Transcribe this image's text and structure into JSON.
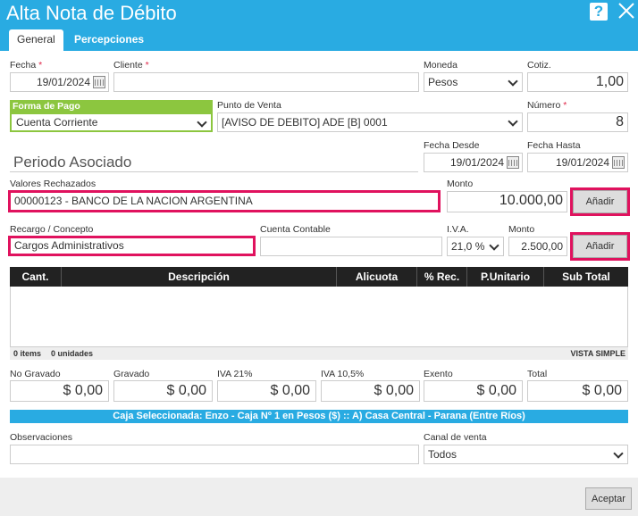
{
  "window": {
    "title": "Alta Nota de Débito",
    "help": "?"
  },
  "tabs": [
    "General",
    "Percepciones"
  ],
  "fields": {
    "fecha": {
      "label": "Fecha",
      "req": "*",
      "value": "19/01/2024"
    },
    "cliente": {
      "label": "Cliente",
      "req": "*",
      "value": ""
    },
    "moneda": {
      "label": "Moneda",
      "value": "Pesos"
    },
    "cotiz": {
      "label": "Cotiz.",
      "value": "1,00"
    },
    "forma_pago": {
      "label": "Forma de Pago",
      "value": "Cuenta Corriente"
    },
    "punto_venta": {
      "label": "Punto de Venta",
      "value": "[AVISO DE DEBITO] ADE [B] 0001"
    },
    "numero": {
      "label": "Número",
      "req": "*",
      "value": "8"
    },
    "periodo": {
      "label": "Periodo Asociado"
    },
    "fecha_desde": {
      "label": "Fecha Desde",
      "value": "19/01/2024"
    },
    "fecha_hasta": {
      "label": "Fecha Hasta",
      "value": "19/01/2024"
    },
    "valores": {
      "label": "Valores Rechazados",
      "value": "00000123 - BANCO DE LA NACION ARGENTINA"
    },
    "monto1": {
      "label": "Monto",
      "value": "10.000,00"
    },
    "add1": "Añadir",
    "recargo": {
      "label": "Recargo / Concepto",
      "value": "Cargos Administrativos"
    },
    "cuenta": {
      "label": "Cuenta Contable",
      "value": ""
    },
    "iva": {
      "label": "I.V.A.",
      "value": "21,0 %"
    },
    "monto2": {
      "label": "Monto",
      "value": "2.500,00"
    },
    "add2": "Añadir"
  },
  "table": {
    "headers": [
      "Cant.",
      "Descripción",
      "Alicuota",
      "% Rec.",
      "P.Unitario",
      "Sub Total"
    ],
    "items": "0 items",
    "units": "0 unidades",
    "mode": "VISTA SIMPLE"
  },
  "totals": [
    {
      "label": "No Gravado",
      "value": "$ 0,00"
    },
    {
      "label": "Gravado",
      "value": "$ 0,00"
    },
    {
      "label": "IVA 21%",
      "value": "$ 0,00"
    },
    {
      "label": "IVA 10,5%",
      "value": "$ 0,00"
    },
    {
      "label": "Exento",
      "value": "$ 0,00"
    },
    {
      "label": "Total",
      "value": "$ 0,00"
    }
  ],
  "caja": "Caja Seleccionada: Enzo - Caja Nº 1 en Pesos ($) :: A) Casa Central - Parana (Entre Ríos)",
  "obs": {
    "label": "Observaciones",
    "value": ""
  },
  "canal": {
    "label": "Canal de venta",
    "value": "Todos"
  },
  "accept": "Aceptar"
}
